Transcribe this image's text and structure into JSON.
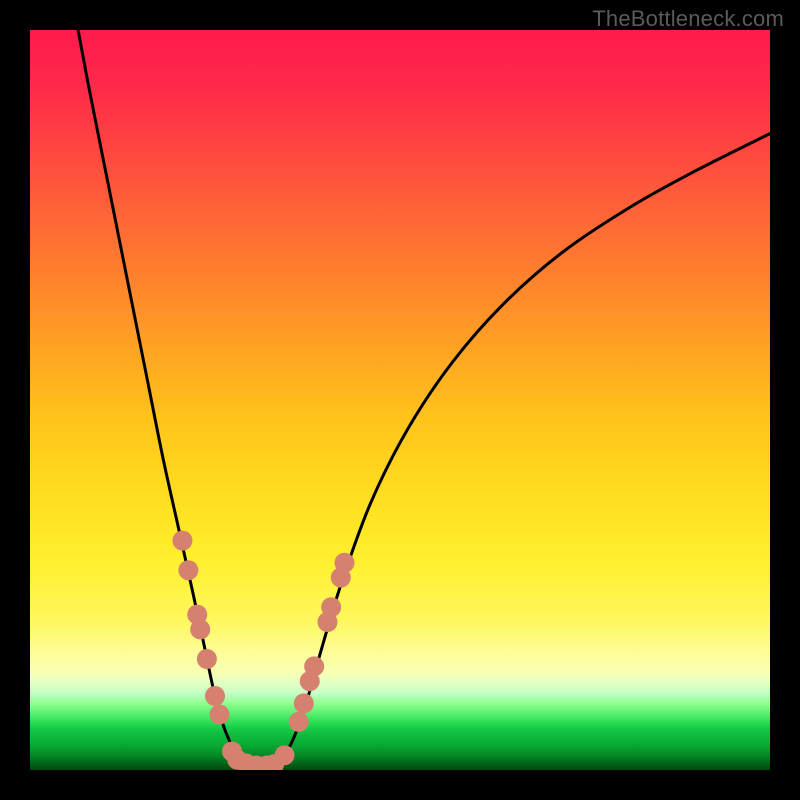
{
  "watermark": {
    "text": "TheBottleneck.com"
  },
  "colors": {
    "curve_stroke": "#000000",
    "marker_fill": "#d6806f",
    "marker_stroke": "#b96a5a",
    "background_top": "#ff1a4d",
    "background_mid": "#ffe020",
    "background_bottom": "#00480f"
  },
  "chart_data": {
    "type": "line",
    "title": "",
    "xlabel": "",
    "ylabel": "",
    "xlim": [
      0,
      100
    ],
    "ylim": [
      0,
      100
    ],
    "grid": false,
    "legend": false,
    "curve_left": {
      "comment": "Left descending branch of V-curve; x,y in 0..100 plot space",
      "points": [
        [
          6.5,
          100
        ],
        [
          8,
          92
        ],
        [
          10,
          82
        ],
        [
          12,
          72
        ],
        [
          14,
          62
        ],
        [
          16,
          52
        ],
        [
          18,
          42
        ],
        [
          20,
          33
        ],
        [
          22,
          24
        ],
        [
          23.5,
          17
        ],
        [
          25,
          10
        ],
        [
          26.5,
          5
        ],
        [
          28.5,
          1.2
        ],
        [
          30,
          0.6
        ]
      ]
    },
    "curve_flat": {
      "comment": "Narrow flat bottom",
      "points": [
        [
          30,
          0.6
        ],
        [
          33,
          0.6
        ]
      ]
    },
    "curve_right": {
      "comment": "Right ascending branch, concave-down",
      "points": [
        [
          33,
          0.6
        ],
        [
          35,
          3
        ],
        [
          37,
          8
        ],
        [
          39,
          15
        ],
        [
          42,
          25
        ],
        [
          46,
          36
        ],
        [
          51,
          46
        ],
        [
          57,
          55
        ],
        [
          64,
          63
        ],
        [
          72,
          70
        ],
        [
          81,
          76
        ],
        [
          90,
          81
        ],
        [
          100,
          86
        ]
      ]
    },
    "markers_left": {
      "comment": "Pink dots on left branch (x, y in 0..100 plot space)",
      "points": [
        [
          20.6,
          31
        ],
        [
          21.4,
          27
        ],
        [
          22.6,
          21
        ],
        [
          23.0,
          19
        ],
        [
          23.9,
          15
        ],
        [
          25.0,
          10
        ],
        [
          25.6,
          7.5
        ],
        [
          27.3,
          2.5
        ],
        [
          28.0,
          1.4
        ],
        [
          29.2,
          0.9
        ],
        [
          30.6,
          0.6
        ]
      ]
    },
    "markers_right": {
      "comment": "Pink dots on right branch",
      "points": [
        [
          32.0,
          0.6
        ],
        [
          33.0,
          0.8
        ],
        [
          34.4,
          2.0
        ],
        [
          36.3,
          6.5
        ],
        [
          37.0,
          9.0
        ],
        [
          37.8,
          12.0
        ],
        [
          38.4,
          14.0
        ],
        [
          40.2,
          20.0
        ],
        [
          40.7,
          22.0
        ],
        [
          42.0,
          26.0
        ],
        [
          42.5,
          28.0
        ]
      ]
    }
  }
}
